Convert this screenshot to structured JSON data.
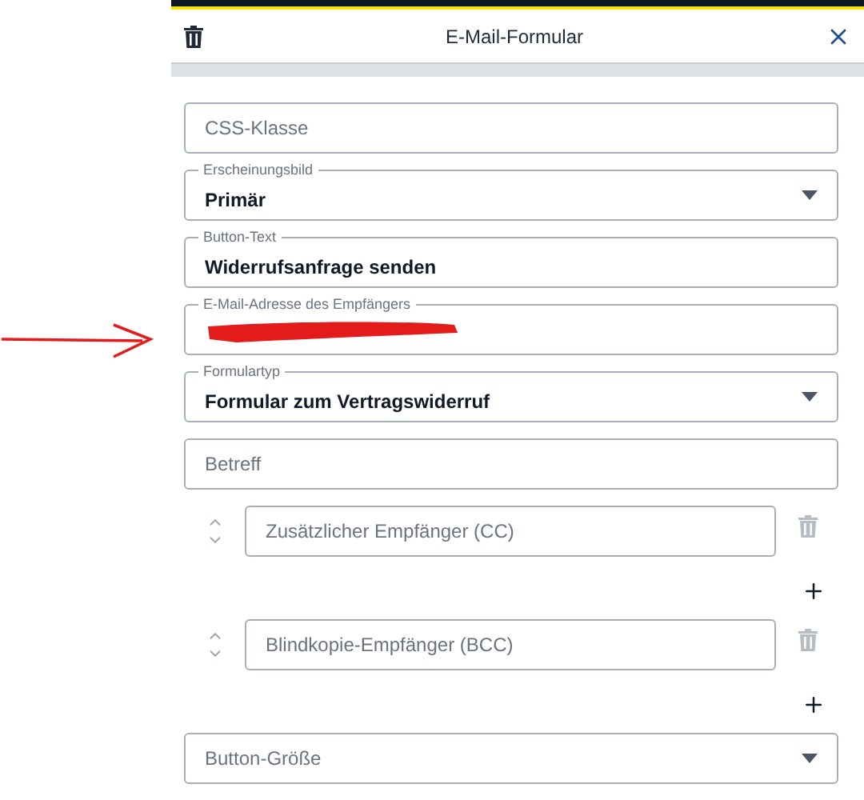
{
  "dialog": {
    "title": "E-Mail-Formular"
  },
  "fields": [
    {
      "kind": "text",
      "placeholder": "CSS-Klasse"
    },
    {
      "kind": "select",
      "label": "Erscheinungsbild",
      "value": "Primär"
    },
    {
      "kind": "text",
      "label": "Button-Text",
      "value": "Widerrufsanfrage senden"
    },
    {
      "kind": "redacted",
      "label": "E-Mail-Adresse des Empfängers"
    },
    {
      "kind": "select",
      "label": "Formulartyp",
      "value": "Formular zum Vertragswiderruf"
    },
    {
      "kind": "text",
      "placeholder": "Betreff"
    }
  ],
  "recipients": [
    {
      "placeholder": "Zusätzlicher Empfänger (CC)"
    },
    {
      "placeholder": "Blindkopie-Empfänger (BCC)"
    }
  ],
  "size_field": {
    "kind": "select",
    "placeholder": "Button-Größe"
  }
}
